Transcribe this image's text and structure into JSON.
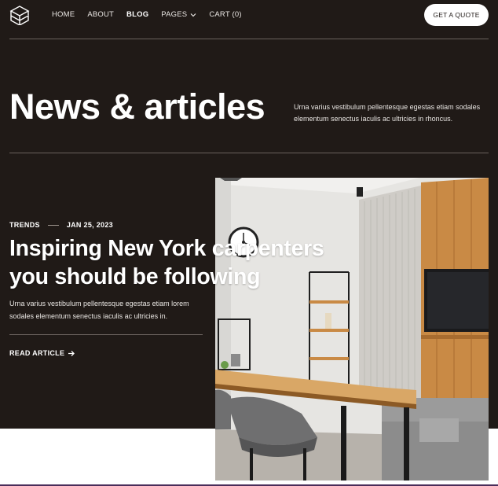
{
  "nav": {
    "items": [
      {
        "label": "HOME",
        "active": false
      },
      {
        "label": "ABOUT",
        "active": false
      },
      {
        "label": "BLOG",
        "active": true
      },
      {
        "label": "PAGES",
        "active": false,
        "dropdown": true
      },
      {
        "label": "CART (0)",
        "active": false
      }
    ],
    "cta_label": "GET A QUOTE"
  },
  "hero": {
    "title": "News & articles",
    "intro": "Urna varius vestibulum pellentesque egestas etiam sodales elementum senectus iaculis ac ultricies in rhoncus."
  },
  "featured": {
    "category": "TRENDS",
    "date": "JAN 25, 2023",
    "headline": "Inspiring New York carpenters you should be following",
    "excerpt": "Urna varius vestibulum pellentesque egestas etiam lorem sodales elementum senectus iaculis ac ultricies in.",
    "read_more": "READ ARTICLE",
    "image": "interior-dining-room-photo"
  },
  "colors": {
    "background_dark": "#201a17",
    "text_light": "#ffffff",
    "accent_line": "#4a2d5a"
  }
}
